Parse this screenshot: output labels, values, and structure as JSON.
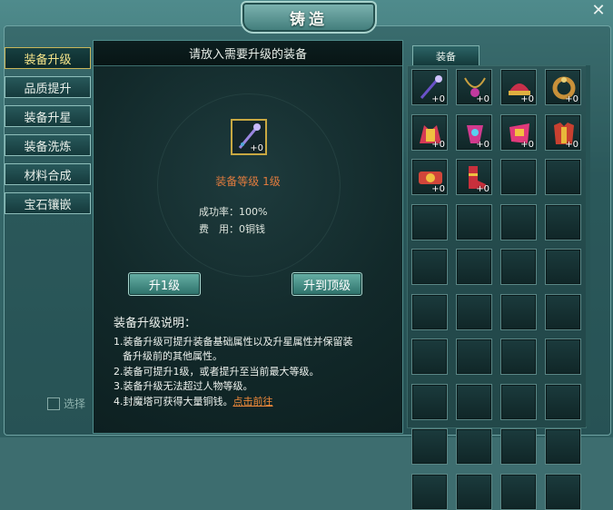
{
  "window": {
    "title": "铸造",
    "close_label": "✕"
  },
  "sidebar": {
    "items": [
      {
        "label": "装备升级",
        "active": true
      },
      {
        "label": "品质提升",
        "active": false
      },
      {
        "label": "装备升星",
        "active": false
      },
      {
        "label": "装备洗炼",
        "active": false
      },
      {
        "label": "材料合成",
        "active": false
      },
      {
        "label": "宝石镶嵌",
        "active": false
      }
    ],
    "select_label": "选择"
  },
  "center": {
    "header": "请放入需要升级的装备",
    "slot_count": "+0",
    "slot_icon": "staff-icon",
    "level_text": "装备等级 1级",
    "success_rate": "成功率：100%",
    "cost": "费　用：0铜钱",
    "btn_upgrade": "升1级",
    "btn_max": "升到顶级",
    "desc_title": "装备升级说明：",
    "desc_lines": [
      "1.装备升级可提升装备基础属性以及升星属性并保留装",
      "备升级前的其他属性。",
      "2.装备可提升1级，或者提升至当前最大等级。",
      "3.装备升级无法超过人物等级。",
      "4.封魔塔可获得大量铜钱。"
    ],
    "desc_link": "点击前往"
  },
  "inventory": {
    "tab_label": "装备",
    "items": [
      {
        "icon": "staff-icon",
        "count": "+0",
        "color": "#6a52c8"
      },
      {
        "icon": "necklace-icon",
        "count": "+0",
        "color": "#c23a9e"
      },
      {
        "icon": "helmet-icon",
        "count": "+0",
        "color": "#c8304a"
      },
      {
        "icon": "ring-icon",
        "count": "+0",
        "color": "#c9913a"
      },
      {
        "icon": "shoulder-icon",
        "count": "+0",
        "color": "#d63a55"
      },
      {
        "icon": "amulet-icon",
        "count": "+0",
        "color": "#d23a8e"
      },
      {
        "icon": "bracer-icon",
        "count": "+0",
        "color": "#e23a7a"
      },
      {
        "icon": "armor-icon",
        "count": "+0",
        "color": "#c84030"
      },
      {
        "icon": "belt-icon",
        "count": "+0",
        "color": "#d2463a"
      },
      {
        "icon": "boots-icon",
        "count": "+0",
        "color": "#c8303c"
      }
    ],
    "empty_slots": 30
  }
}
